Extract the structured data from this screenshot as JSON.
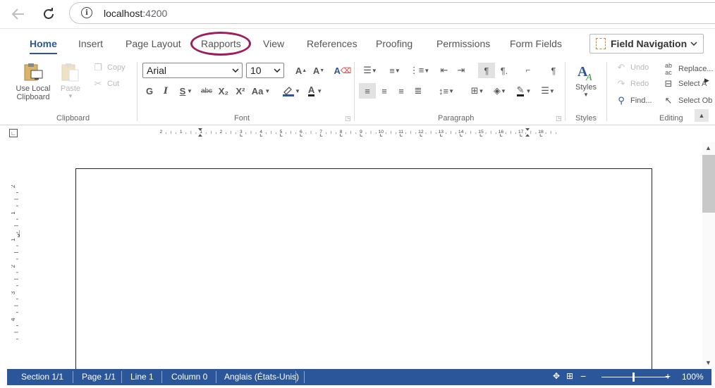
{
  "browser": {
    "url_host": "localhost",
    "url_port": ":4200"
  },
  "tabs": [
    {
      "label": "Home",
      "active": true
    },
    {
      "label": "Insert"
    },
    {
      "label": "Page Layout"
    },
    {
      "label": "Rapports"
    },
    {
      "label": "View"
    },
    {
      "label": "References"
    },
    {
      "label": "Proofing"
    },
    {
      "label": "Permissions"
    },
    {
      "label": "Form Fields"
    }
  ],
  "field_navigation": {
    "label": "Field Navigation"
  },
  "clipboard": {
    "use_local_line1": "Use Local",
    "use_local_line2": "Clipboard",
    "paste": "Paste",
    "copy": "Copy",
    "cut": "Cut",
    "group_label": "Clipboard"
  },
  "font": {
    "family": "Arial",
    "size": "10",
    "bold": "G",
    "italic": "I",
    "underline": "S",
    "strike": "abc",
    "subscript": "X₂",
    "superscript": "X²",
    "case": "Aa",
    "group_label": "Font"
  },
  "paragraph": {
    "group_label": "Paragraph"
  },
  "styles": {
    "label": "Styles",
    "group_label": "Styles"
  },
  "editing": {
    "undo": "Undo",
    "redo": "Redo",
    "find": "Find...",
    "replace": "Replace...",
    "select_all": "Select A",
    "select_objects": "Select Ob",
    "group_label": "Editing"
  },
  "ruler": {
    "marks": [
      "2",
      "1",
      "1",
      "2",
      "3",
      "4",
      "5",
      "6",
      "7",
      "8",
      "9",
      "10",
      "11",
      "12",
      "13",
      "14",
      "15",
      "16",
      "17",
      "18"
    ]
  },
  "vertical_ruler": {
    "marks": [
      "2",
      "1",
      "1",
      "2",
      "3",
      "4"
    ]
  },
  "status": {
    "section": "Section 1/1",
    "page": "Page 1/1",
    "line": "Line 1",
    "column": "Column 0",
    "language": "Anglais (États-Unis)",
    "zoom": "100%"
  },
  "colors": {
    "accent": "#2b5797",
    "status_bar": "#2b579a",
    "highlight_ring": "#9c1e5f"
  }
}
